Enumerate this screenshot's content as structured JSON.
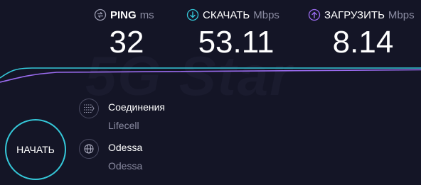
{
  "watermark": "5G Star",
  "ping": {
    "label": "PING",
    "unit": "ms",
    "value": "32",
    "icon": "ping-icon"
  },
  "download": {
    "label": "СКАЧАТЬ",
    "unit": "Mbps",
    "value": "53.11",
    "icon": "download-arrow-icon"
  },
  "upload": {
    "label": "ЗАГРУЗИТЬ",
    "unit": "Mbps",
    "value": "8.14",
    "icon": "upload-arrow-icon"
  },
  "connections": {
    "title": "Соединения",
    "provider": "Lifecell",
    "icon": "connections-icon"
  },
  "server": {
    "title": "Odessa",
    "location": "Odessa",
    "icon": "globe-icon"
  },
  "go_button": {
    "label": "НАЧАТЬ"
  },
  "colors": {
    "background": "#141526",
    "download_accent": "#35c8d9",
    "upload_accent": "#9b6cf0",
    "muted_text": "#8a8ba1"
  }
}
